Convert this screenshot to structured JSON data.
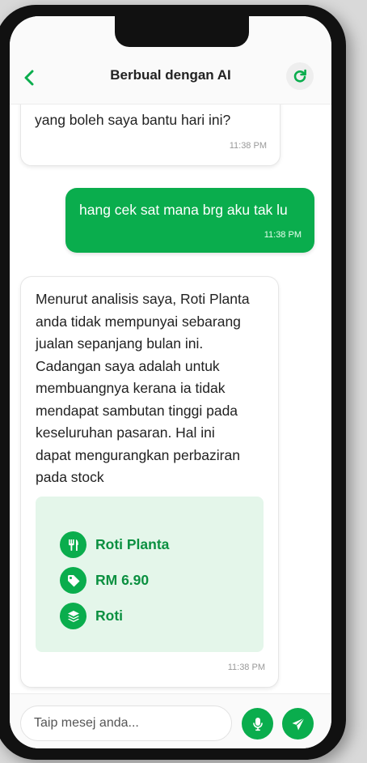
{
  "header": {
    "title": "Berbual dengan AI",
    "back_icon": "chevron-left-icon",
    "refresh_icon": "refresh-icon"
  },
  "messages": [
    {
      "sender": "ai",
      "text": "yang boleh saya bantu hari ini?",
      "time": "11:38 PM"
    },
    {
      "sender": "user",
      "text": "hang cek sat mana brg aku tak lu",
      "time": "11:38 PM"
    },
    {
      "sender": "ai",
      "lines": [
        "Menurut analisis saya, Roti Planta",
        "anda tidak mempunyai sebarang",
        "jualan sepanjang bulan ini.",
        "Cadangan saya adalah untuk",
        "membuangnya kerana ia tidak",
        "mendapat sambutan tinggi pada",
        "keseluruhan pasaran. Hal ini",
        "dapat mengurangkan perbaziran",
        "pada stock"
      ],
      "product": {
        "name": "Roti Planta",
        "price": "RM 6.90",
        "category": "Roti"
      },
      "time": "11:38 PM"
    }
  ],
  "footer": {
    "placeholder": "Taip mesej anda...",
    "mic_icon": "microphone-icon",
    "send_icon": "send-icon"
  },
  "colors": {
    "accent": "#0aad4d",
    "card_bg": "#e4f6ea",
    "product_text": "#0a9040"
  }
}
